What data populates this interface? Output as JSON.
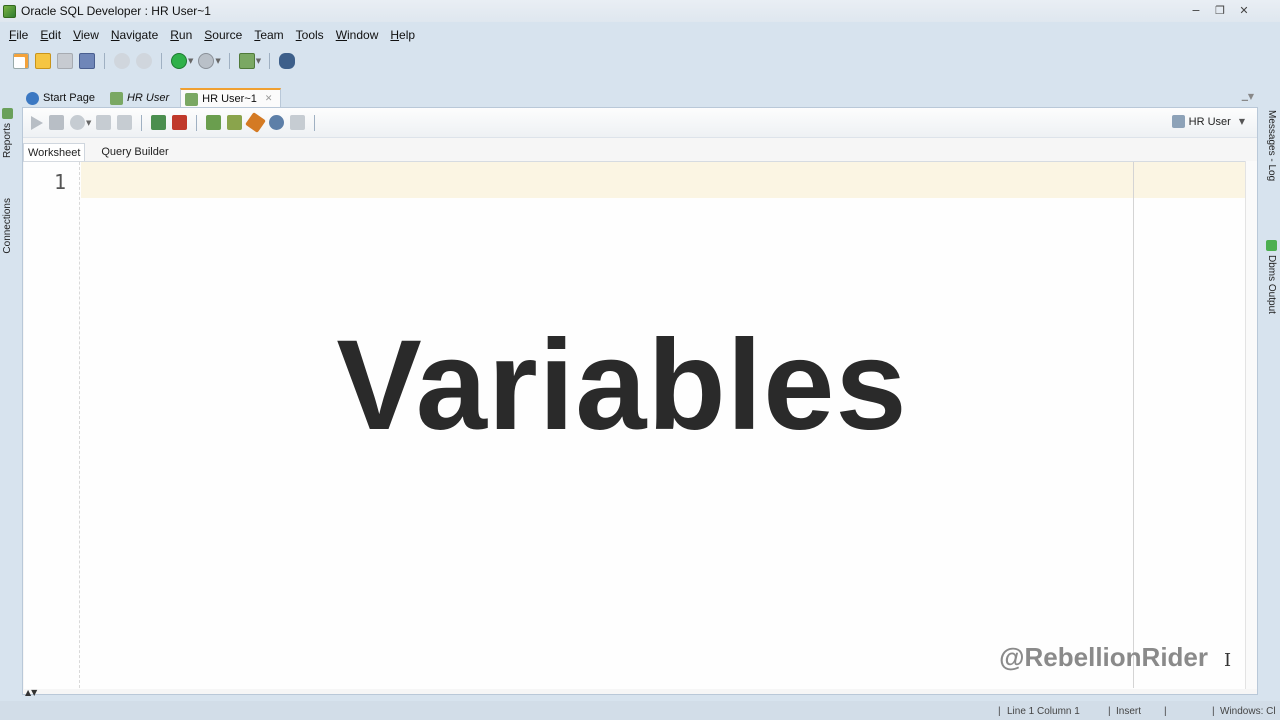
{
  "window": {
    "title": "Oracle SQL Developer : HR User~1",
    "controls": {
      "minimize": "−",
      "restore": "❐",
      "close": "✕"
    }
  },
  "menubar": {
    "items": [
      {
        "label": "File",
        "underline": "F",
        "rest": "ile"
      },
      {
        "label": "Edit",
        "underline": "E",
        "rest": "dit"
      },
      {
        "label": "View",
        "underline": "V",
        "rest": "iew"
      },
      {
        "label": "Navigate",
        "underline": "N",
        "rest": "avigate"
      },
      {
        "label": "Run",
        "underline": "R",
        "rest": "un"
      },
      {
        "label": "Source",
        "underline": "S",
        "rest": "ource"
      },
      {
        "label": "Team",
        "underline": "T",
        "rest": "eam"
      },
      {
        "label": "Tools",
        "underline": "T",
        "rest": "ools"
      },
      {
        "label": "Window",
        "underline": "W",
        "rest": "indow"
      },
      {
        "label": "Help",
        "underline": "H",
        "rest": "elp"
      }
    ]
  },
  "side_panels": {
    "left": [
      "Reports",
      "Connections"
    ],
    "right": [
      "Messages - Log",
      "Dbms Output"
    ]
  },
  "doc_tabs": [
    {
      "label": "Start Page",
      "italic": false
    },
    {
      "label": "HR User",
      "italic": true
    },
    {
      "label": "HR User~1",
      "italic": false,
      "active": true
    }
  ],
  "worksheet": {
    "connection": "HR User",
    "subtabs": [
      "Worksheet",
      "Query Builder"
    ],
    "line_number": "1"
  },
  "overlay": {
    "title": "Variables",
    "brand": "@RebellionRider"
  },
  "statusbar": {
    "position": "Line 1 Column 1",
    "mode": "Insert",
    "eol": "Windows: Cl"
  },
  "colors": {
    "accent_tab": "#f0a030",
    "current_line": "#fbf5e3",
    "chrome": "#d7e3ee"
  }
}
